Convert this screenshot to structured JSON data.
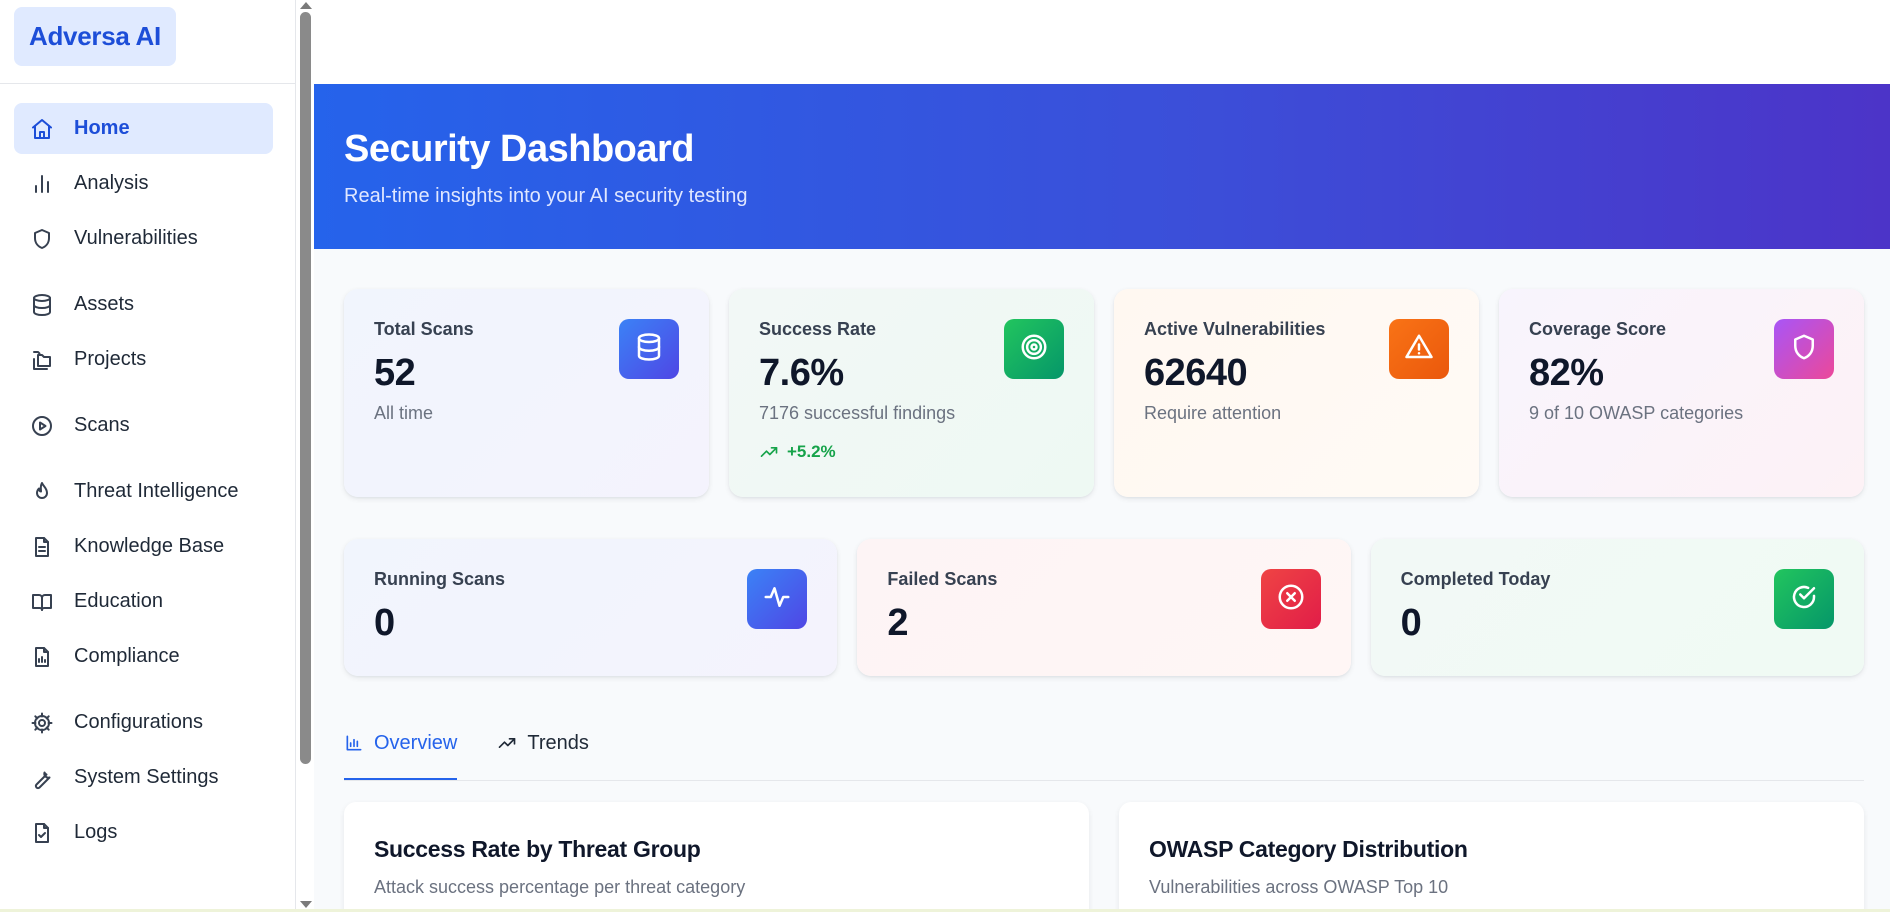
{
  "brand": "Adversa AI",
  "sidebar": {
    "groups": [
      [
        {
          "label": "Home",
          "icon": "home-icon",
          "active": true
        },
        {
          "label": "Analysis",
          "icon": "bar-chart-icon"
        },
        {
          "label": "Vulnerabilities",
          "icon": "shield-icon"
        }
      ],
      [
        {
          "label": "Assets",
          "icon": "database-icon"
        },
        {
          "label": "Projects",
          "icon": "folders-icon"
        }
      ],
      [
        {
          "label": "Scans",
          "icon": "play-circle-icon"
        }
      ],
      [
        {
          "label": "Threat Intelligence",
          "icon": "flame-icon"
        },
        {
          "label": "Knowledge Base",
          "icon": "file-text-icon"
        },
        {
          "label": "Education",
          "icon": "book-open-icon"
        },
        {
          "label": "Compliance",
          "icon": "file-chart-icon"
        }
      ],
      [
        {
          "label": "Configurations",
          "icon": "gear-icon"
        },
        {
          "label": "System Settings",
          "icon": "wrench-icon"
        },
        {
          "label": "Logs",
          "icon": "file-check-icon"
        }
      ]
    ]
  },
  "hero": {
    "title": "Security Dashboard",
    "subtitle": "Real-time insights into your AI security testing"
  },
  "stats": [
    {
      "title": "Total Scans",
      "value": "52",
      "sub": "All time",
      "icon": "database-icon"
    },
    {
      "title": "Success Rate",
      "value": "7.6%",
      "sub": "7176 successful findings",
      "trend": "+5.2%",
      "icon": "target-icon"
    },
    {
      "title": "Active Vulnerabilities",
      "value": "62640",
      "sub": "Require attention",
      "icon": "alert-triangle-icon"
    },
    {
      "title": "Coverage Score",
      "value": "82%",
      "sub": "9 of 10 OWASP categories",
      "icon": "shield-icon"
    }
  ],
  "status": [
    {
      "title": "Running Scans",
      "value": "0",
      "icon": "activity-icon"
    },
    {
      "title": "Failed Scans",
      "value": "2",
      "icon": "x-circle-icon"
    },
    {
      "title": "Completed Today",
      "value": "0",
      "icon": "check-circle-icon"
    }
  ],
  "tabs": [
    {
      "label": "Overview",
      "icon": "bar-chart-icon",
      "active": true
    },
    {
      "label": "Trends",
      "icon": "trending-up-icon"
    }
  ],
  "panels": [
    {
      "title": "Success Rate by Threat Group",
      "subtitle": "Attack success percentage per threat category"
    },
    {
      "title": "OWASP Category Distribution",
      "subtitle": "Vulnerabilities across OWASP Top 10"
    }
  ],
  "colors": {
    "accent": "#2563eb",
    "hero_start": "#2563eb",
    "hero_end": "#4c34c8",
    "success": "#16a34a"
  }
}
